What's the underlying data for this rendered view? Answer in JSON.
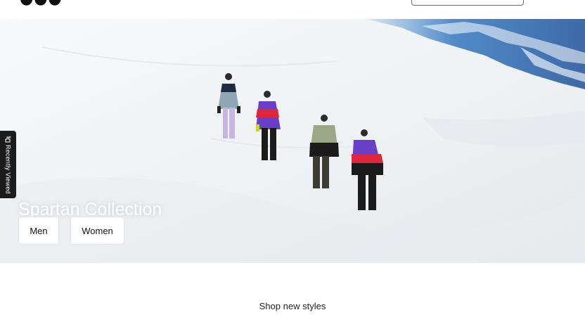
{
  "header": {
    "logo_text": "",
    "search": {
      "icon": "search-box"
    }
  },
  "hero": {
    "title": "Spartan Collection",
    "buttons": {
      "men": "Men",
      "women": "Women"
    },
    "skiers": [
      {
        "jacket": "#5a6e7a",
        "accent": "#1d2c44",
        "pants": "#c8b6e2"
      },
      {
        "jacket": "#6a3fc8",
        "accent": "#e0263b",
        "pants": "#1b1b1b"
      },
      {
        "jacket": "#7c8a6e",
        "accent": "#1b1b1b",
        "pants": "#3c3c34"
      },
      {
        "jacket": "#6a3fc8",
        "accent": "#e0263b",
        "pants": "#1b1b1b"
      }
    ]
  },
  "recently_viewed": {
    "label": "Recently Viewed",
    "icon": "sparkle-hand-icon"
  },
  "section": {
    "shop_new_styles": "Shop new styles"
  },
  "colors": {
    "glacier": "#3f7fc4",
    "snow": "#f4f6f8",
    "tab_bg": "#1c1c1c"
  }
}
